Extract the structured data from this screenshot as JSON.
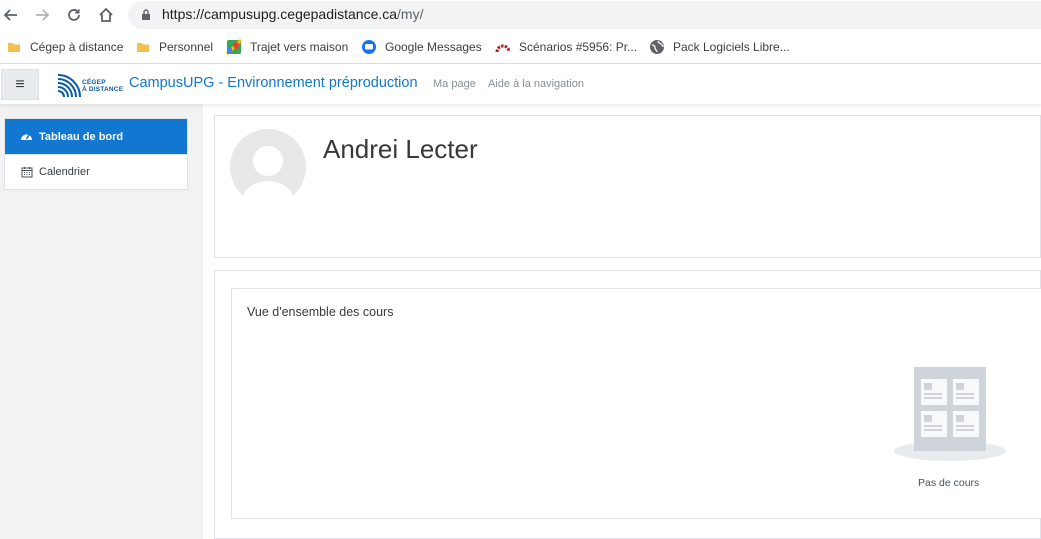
{
  "browser": {
    "url_host": "https://campusupg.cegepadistance.ca",
    "url_path": "/my/"
  },
  "bookmarks": [
    {
      "label": "Cégep à distance",
      "icon": "folder-icon"
    },
    {
      "label": "Personnel",
      "icon": "folder-icon"
    },
    {
      "label": "Trajet vers maison",
      "icon": "maps-icon"
    },
    {
      "label": "Google Messages",
      "icon": "messages-icon"
    },
    {
      "label": "Scénarios #5956: Pr...",
      "icon": "redmine-icon"
    },
    {
      "label": "Pack Logiciels Libre...",
      "icon": "globe-icon"
    }
  ],
  "navbar": {
    "menu_icon": "≡",
    "logo_text_line1": "CÉGEP",
    "logo_text_line2": "À DISTANCE",
    "site_name": "CampusUPG - Environnement préproduction",
    "links": [
      "Ma page",
      "Aide à la navigation"
    ]
  },
  "drawer": {
    "items": [
      {
        "label": "Tableau de bord",
        "icon": "dashboard-icon",
        "active": true
      },
      {
        "label": "Calendrier",
        "icon": "calendar-icon",
        "active": false
      }
    ]
  },
  "profile": {
    "name": "Andrei Lecter"
  },
  "course_overview": {
    "title": "Vue d'ensemble des cours",
    "empty_message": "Pas de cours"
  },
  "colors": {
    "accent": "#1177d1",
    "drawer_bg": "#f2f2f2",
    "border": "#dee2e6"
  }
}
